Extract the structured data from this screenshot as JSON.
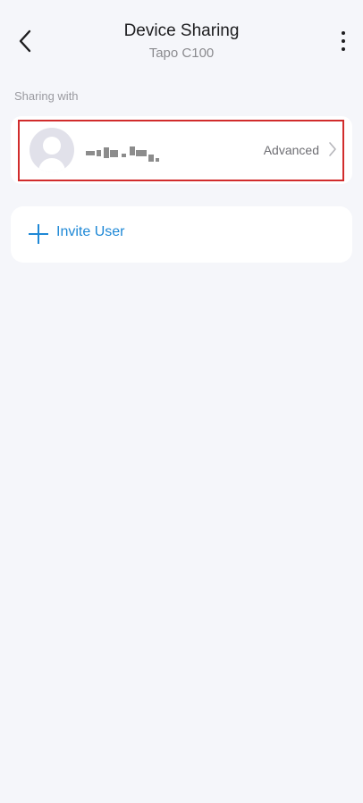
{
  "header": {
    "title": "Device Sharing",
    "subtitle": "Tapo C100",
    "back_icon": "chevron-left-icon",
    "more_icon": "more-vertical-icon"
  },
  "sharing": {
    "section_label": "Sharing with",
    "users": [
      {
        "name": "",
        "name_masked": true,
        "role_label": "Advanced"
      }
    ]
  },
  "invite": {
    "label": "Invite User",
    "icon": "plus-icon"
  },
  "colors": {
    "accent": "#1e88d6",
    "highlight_border": "#d12c2c",
    "background": "#f5f6fa"
  }
}
